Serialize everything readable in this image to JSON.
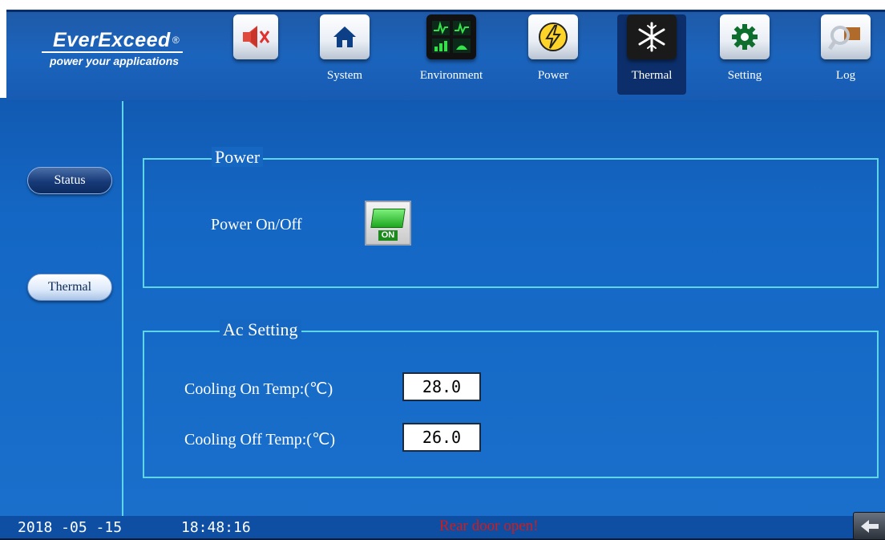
{
  "brand": {
    "name": "EverExceed",
    "reg_mark": "®",
    "tagline": "power your applications"
  },
  "nav": {
    "mute_icon": "speaker-muted-icon",
    "items": [
      {
        "label": "System",
        "icon": "home-icon"
      },
      {
        "label": "Environment",
        "icon": "environment-monitor-icon"
      },
      {
        "label": "Power",
        "icon": "lightning-icon"
      },
      {
        "label": "Thermal",
        "icon": "snowflake-icon",
        "active": true
      },
      {
        "label": "Setting",
        "icon": "gear-icon"
      },
      {
        "label": "Log",
        "icon": "magnifier-icon"
      }
    ]
  },
  "sidebar": {
    "items": [
      {
        "label": "Status"
      },
      {
        "label": "Thermal",
        "selected": true
      }
    ]
  },
  "power_group": {
    "title": "Power",
    "power_label": "Power On/Off",
    "switch_state": "ON"
  },
  "ac_group": {
    "title": "Ac Setting",
    "cooling_on_label": "Cooling On Temp:(℃)",
    "cooling_on_value": "28.0",
    "cooling_off_label": "Cooling Off Temp:(℃)",
    "cooling_off_value": "26.0"
  },
  "status_bar": {
    "date": "2018 -05 -15",
    "time": "18:48:16",
    "alarm": "Rear door open!"
  },
  "colors": {
    "accent_cyan": "#5fd6e6",
    "alarm_red": "#d51a1a",
    "switch_green": "#1fa71f"
  }
}
